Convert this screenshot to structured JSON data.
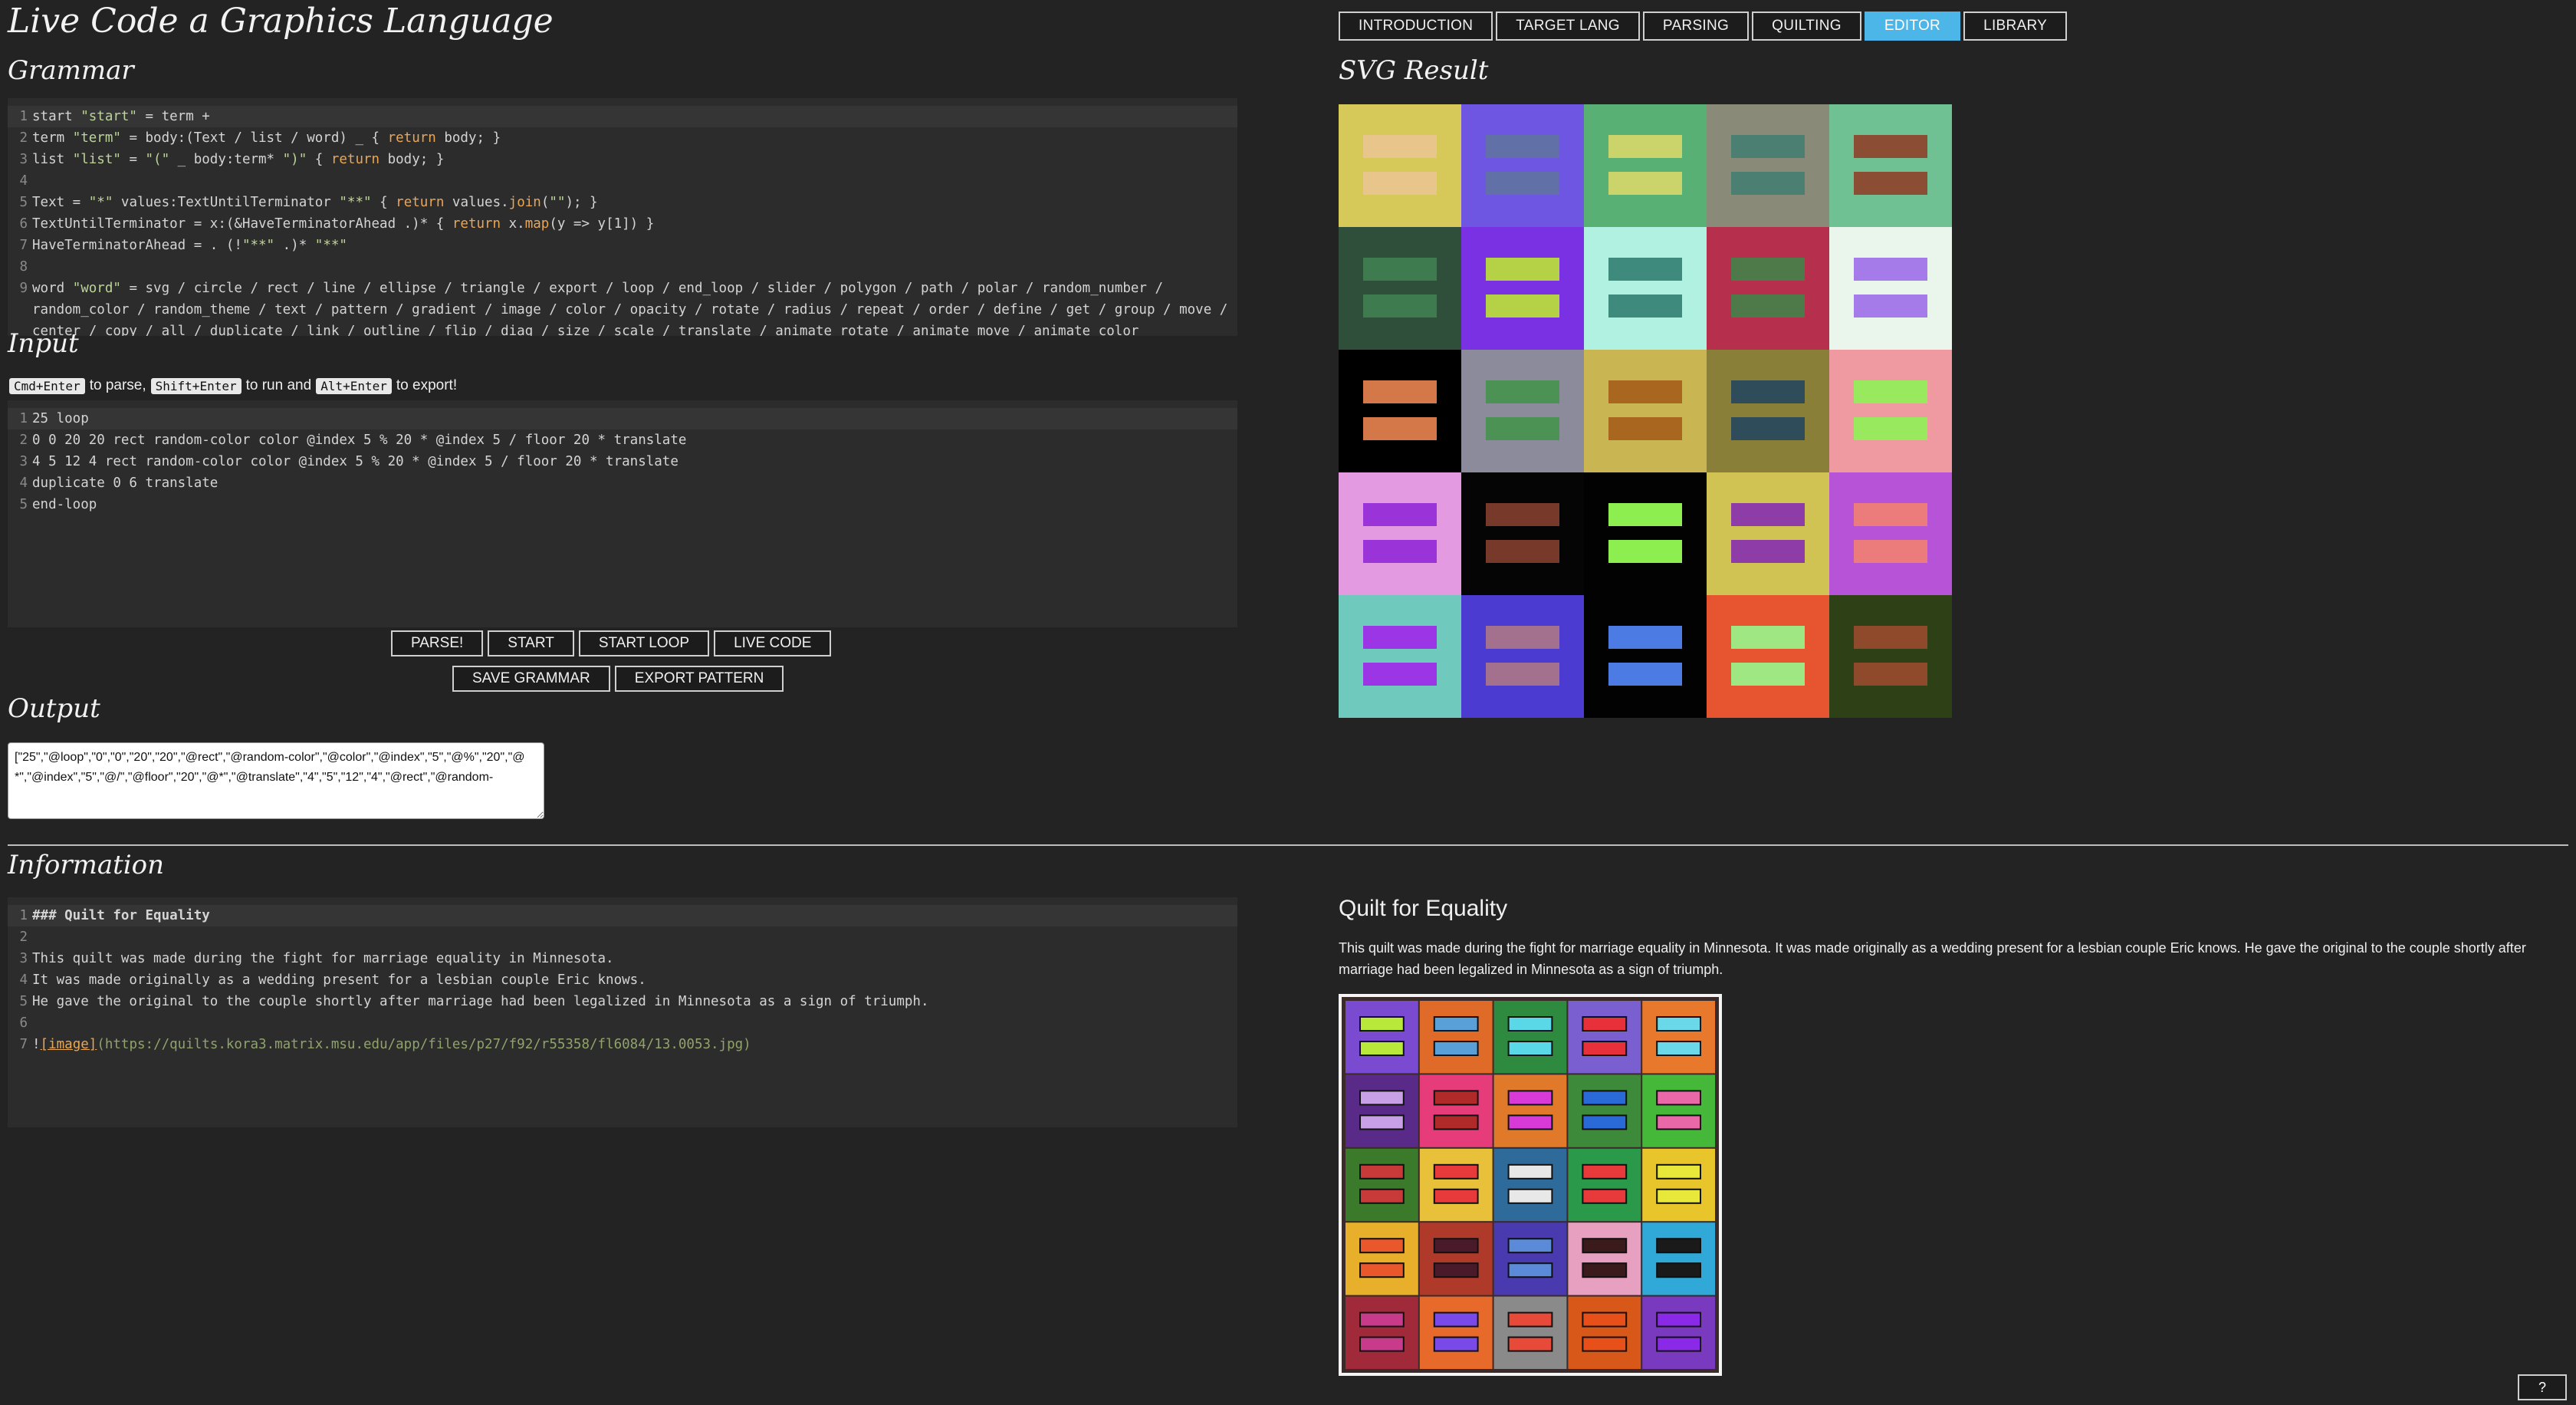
{
  "app": {
    "title": "Live Code a Graphics Language"
  },
  "nav": {
    "tabs": [
      {
        "label": "INTRODUCTION"
      },
      {
        "label": "TARGET LANG"
      },
      {
        "label": "PARSING"
      },
      {
        "label": "QUILTING"
      },
      {
        "label": "EDITOR"
      },
      {
        "label": "LIBRARY"
      }
    ],
    "active": "EDITOR"
  },
  "grammar": {
    "heading": "Grammar",
    "lines": [
      {
        "n": "1",
        "parts": [
          [
            "start ",
            ""
          ],
          [
            "\"start\"",
            "str"
          ],
          [
            " = term +",
            ""
          ]
        ]
      },
      {
        "n": "2",
        "parts": [
          [
            "term ",
            ""
          ],
          [
            "\"term\"",
            "str"
          ],
          [
            " = body:(Text / list / word) _ { ",
            ""
          ],
          [
            "return",
            "kw"
          ],
          [
            " body; }",
            ""
          ]
        ]
      },
      {
        "n": "3",
        "parts": [
          [
            "list ",
            ""
          ],
          [
            "\"list\"",
            "str"
          ],
          [
            " = ",
            ""
          ],
          [
            "\"(\"",
            "str"
          ],
          [
            " _ body:term* ",
            ""
          ],
          [
            "\")\"",
            "str"
          ],
          [
            " { ",
            ""
          ],
          [
            "return",
            "kw"
          ],
          [
            " body; }",
            ""
          ]
        ]
      },
      {
        "n": "4",
        "parts": []
      },
      {
        "n": "5",
        "parts": [
          [
            "Text = ",
            ""
          ],
          [
            "\"*\"",
            "str"
          ],
          [
            " values:TextUntilTerminator ",
            ""
          ],
          [
            "\"**\"",
            "str"
          ],
          [
            " { ",
            ""
          ],
          [
            "return",
            "kw"
          ],
          [
            " values.",
            ""
          ],
          [
            "join",
            "kw"
          ],
          [
            "(",
            ""
          ],
          [
            "\"\"",
            "str"
          ],
          [
            "); }",
            ""
          ]
        ]
      },
      {
        "n": "6",
        "parts": [
          [
            "TextUntilTerminator = x:(&HaveTerminatorAhead .)* { ",
            ""
          ],
          [
            "return",
            "kw"
          ],
          [
            " x.",
            ""
          ],
          [
            "map",
            "kw"
          ],
          [
            "(y => y[1]) }",
            ""
          ]
        ]
      },
      {
        "n": "7",
        "parts": [
          [
            "HaveTerminatorAhead = . (!",
            ""
          ],
          [
            "\"**\"",
            "str"
          ],
          [
            " .)* ",
            ""
          ],
          [
            "\"**\"",
            "str"
          ]
        ]
      },
      {
        "n": "8",
        "parts": []
      },
      {
        "n": "9",
        "wrap": true,
        "parts": [
          [
            "word ",
            ""
          ],
          [
            "\"word\"",
            "str"
          ],
          [
            " = svg / circle / rect / line / ellipse / triangle / export / loop / end_loop / slider / polygon / path / polar / random_number / random_color / random_theme / text / pattern / gradient / image / color / opacity / rotate / radius / repeat / order / define / get / group / move / center / copy / all / duplicate / link / outline / flip / diag / size / scale / translate / animate_rotate / animate_move / animate_color",
            ""
          ]
        ]
      }
    ]
  },
  "input": {
    "heading": "Input",
    "hint": {
      "k1": "Cmd+Enter",
      "t1": "to parse,",
      "k2": "Shift+Enter",
      "t2": "to run and",
      "k3": "Alt+Enter",
      "t3": "to export!"
    },
    "lines": [
      {
        "n": "1",
        "text": "25 loop"
      },
      {
        "n": "2",
        "text": "0 0 20 20 rect random-color color @index 5 % 20 * @index 5 / floor 20 * translate"
      },
      {
        "n": "3",
        "text": "4 5 12 4 rect random-color color @index 5 % 20 * @index 5 / floor 20 * translate"
      },
      {
        "n": "4",
        "text": "duplicate 0 6 translate"
      },
      {
        "n": "5",
        "text": "end-loop"
      }
    ]
  },
  "buttons": {
    "parse": "PARSE!",
    "start": "START",
    "start_loop": "START LOOP",
    "live_code": "LIVE CODE",
    "save_grammar": "SAVE GRAMMAR",
    "export_pattern": "EXPORT PATTERN"
  },
  "output": {
    "heading": "Output",
    "value": "[\"25\",\"@loop\",\"0\",\"0\",\"20\",\"20\",\"@rect\",\"@random-color\",\"@color\",\"@index\",\"5\",\"@%\",\"20\",\"@*\",\"@index\",\"5\",\"@/\",\"@floor\",\"20\",\"@*\",\"@translate\",\"4\",\"5\",\"12\",\"4\",\"@rect\",\"@random-"
  },
  "svg_result": {
    "heading": "SVG Result",
    "tiles": [
      [
        "#d7c85a",
        "#e8c68b"
      ],
      [
        "#6e55e2",
        "#6270a8"
      ],
      [
        "#58b075",
        "#cbd46a"
      ],
      [
        "#8a8a78",
        "#4b7f72"
      ],
      [
        "#6fc092",
        "#8b4d34"
      ],
      [
        "#2f4f3a",
        "#3e7b4e"
      ],
      [
        "#7a30e3",
        "#b5d247"
      ],
      [
        "#b1f1e1",
        "#3e8a7d"
      ],
      [
        "#b62f4d",
        "#4d7a48"
      ],
      [
        "#eaf5ec",
        "#a57ae9"
      ],
      [
        "#000000",
        "#d4784a"
      ],
      [
        "#8b8b9b",
        "#4b9254"
      ],
      [
        "#c9b653",
        "#a8661e"
      ],
      [
        "#8a7f38",
        "#2f4c5b"
      ],
      [
        "#ee9aa0",
        "#99e95e"
      ],
      [
        "#e49ae1",
        "#9a34d8"
      ],
      [
        "#050505",
        "#77392a"
      ],
      [
        "#020202",
        "#8cef4f"
      ],
      [
        "#d1c353",
        "#8d3ca8"
      ],
      [
        "#b653d6",
        "#ec7c7c"
      ],
      [
        "#6fc9bd",
        "#9c35e6"
      ],
      [
        "#4b3bd1",
        "#a3718e"
      ],
      [
        "#020202",
        "#4c7be4"
      ],
      [
        "#e75430",
        "#9fe782"
      ],
      [
        "#2e4116",
        "#8f4a2c"
      ]
    ]
  },
  "information": {
    "heading": "Information",
    "lines": [
      {
        "n": "1",
        "parts": [
          [
            "### Quilt for Equality",
            "bold"
          ]
        ]
      },
      {
        "n": "2",
        "parts": []
      },
      {
        "n": "3",
        "parts": [
          [
            "This quilt was made during the fight for marriage equality in Minnesota.",
            ""
          ]
        ]
      },
      {
        "n": "4",
        "parts": [
          [
            "It was made originally as a wedding present for a lesbian couple Eric knows.",
            ""
          ]
        ]
      },
      {
        "n": "5",
        "parts": [
          [
            "He gave the original to the couple shortly after marriage had been legalized in Minnesota as a sign of triumph.",
            ""
          ]
        ]
      },
      {
        "n": "6",
        "parts": []
      },
      {
        "n": "7",
        "parts": [
          [
            "!",
            ""
          ],
          [
            "[image]",
            "link"
          ],
          [
            "(https://quilts.kora3.matrix.msu.edu/app/files/p27/f92/r55358/fl6084/13.0053.jpg)",
            "url"
          ]
        ]
      }
    ],
    "rendered_title": "Quilt for Equality",
    "rendered_body": "This quilt was made during the fight for marriage equality in Minnesota. It was made originally as a wedding present for a lesbian couple Eric knows. He gave the original to the couple shortly after marriage had been legalized in Minnesota as a sign of triumph."
  },
  "quilt_photo": {
    "blocks": [
      "#7a4bd0",
      "#e06a28",
      "#2e8a3e",
      "#7a5fd0",
      "#e8782c",
      "#5a2a88",
      "#e63c7a",
      "#e07a2a",
      "#3c8a3a",
      "#45b83a",
      "#3a7a2a",
      "#e8c03a",
      "#2e6a9a",
      "#2a9a4a",
      "#e8c52a",
      "#e8b02a",
      "#b03a2a",
      "#4a3ab0",
      "#e8a0c0",
      "#30a8d8",
      "#a02a3a",
      "#e86a2a",
      "#8a8a8a",
      "#d8581a",
      "#7a3ac0"
    ],
    "bars": [
      "#b8e83a",
      "#5aa0d8",
      "#5ad8e8",
      "#e8303a",
      "#6ad8e8",
      "#c8a0e8",
      "#b02a2a",
      "#d83ad8",
      "#2a6ad8",
      "#e868a8",
      "#c83a3a",
      "#e83a3a",
      "#e8e8e8",
      "#e83a3a",
      "#e8e83a",
      "#e8582a",
      "#4a1a2a",
      "#5a8ad8",
      "#3a1a1a",
      "#1a1a1a",
      "#c83a8a",
      "#7a4ae8",
      "#e84a3a",
      "#e8501a",
      "#8a2ae8"
    ]
  },
  "help": {
    "label": "?"
  }
}
